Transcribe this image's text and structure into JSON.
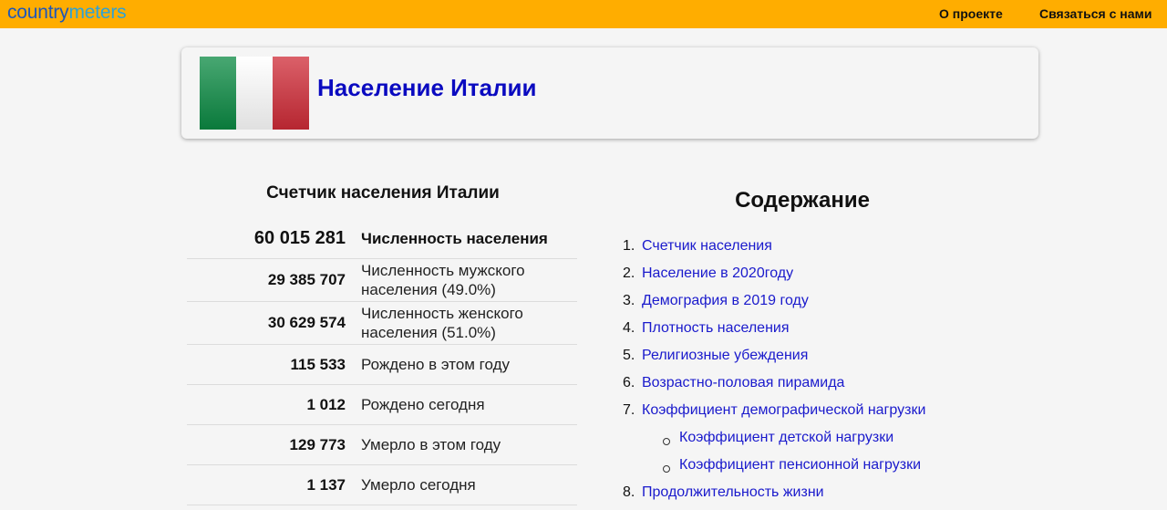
{
  "header": {
    "logo_part1": "country",
    "logo_part2": "meters",
    "nav": [
      "О проекте",
      "Связаться с нами"
    ],
    "brand_color": "#ffad00"
  },
  "title_card": {
    "title": "Население Италии",
    "flag_colors": [
      "#0b8a43",
      "#ffffff",
      "#cf2b37"
    ]
  },
  "counter": {
    "title": "Счетчик населения Италии",
    "rows": [
      {
        "value": "60 015 281",
        "label": "Численность населения"
      },
      {
        "value": "29 385 707",
        "label": "Численность мужского населения (49.0%)"
      },
      {
        "value": "30 629 574",
        "label": "Численность женского населения (51.0%)"
      },
      {
        "value": "115 533",
        "label": "Рождено в этом году"
      },
      {
        "value": "1 012",
        "label": "Рождено сегодня"
      },
      {
        "value": "129 773",
        "label": "Умерло в этом году"
      },
      {
        "value": "1 137",
        "label": "Умерло сегодня"
      }
    ]
  },
  "toc": {
    "title": "Содержание",
    "items": [
      {
        "n": "1.",
        "label": "Счетчик населения"
      },
      {
        "n": "2.",
        "label": "Население в 2020году"
      },
      {
        "n": "3.",
        "label": "Демография в 2019 году"
      },
      {
        "n": "4.",
        "label": "Плотность населения"
      },
      {
        "n": "5.",
        "label": "Религиозные убеждения"
      },
      {
        "n": "6.",
        "label": "Возрастно-половая пирамида"
      },
      {
        "n": "7.",
        "label": "Коэффициент демографической нагрузки"
      },
      {
        "n": "8.",
        "label": "Продолжительность жизни"
      }
    ],
    "subitems": [
      "Коэффициент детской нагрузки",
      "Коэффициент пенсионной нагрузки"
    ]
  }
}
